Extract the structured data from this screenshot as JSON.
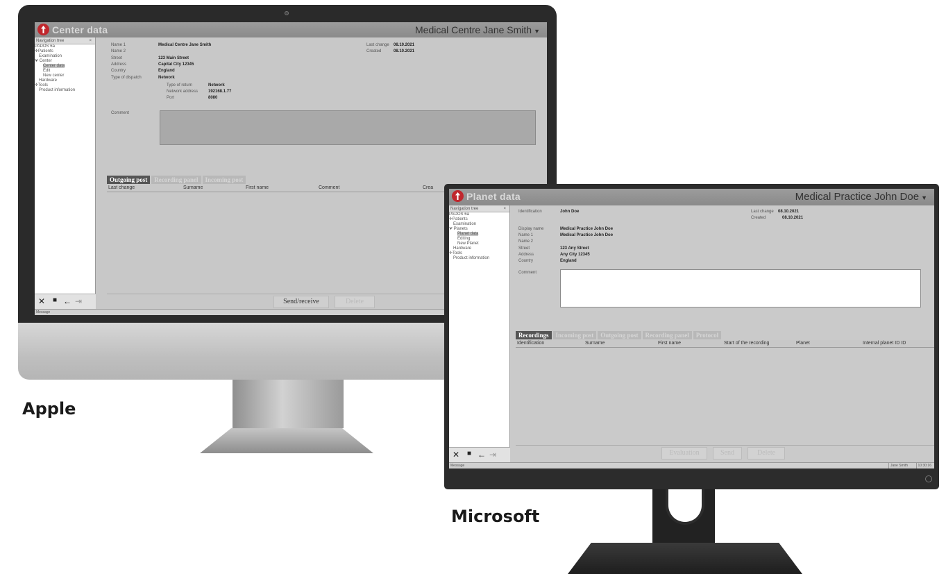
{
  "apple": {
    "caption": "Apple",
    "app": {
      "title": "Center data",
      "user": "Medical Centre Jane Smith",
      "nav": {
        "header": "Navigation tree",
        "items": [
          "PADOS 6a",
          "✛Patients",
          "Examination",
          "⮟ Center",
          "Center data",
          "Edit",
          "New center",
          "Hardware",
          "✛Tools",
          "Product information"
        ]
      },
      "form": {
        "name1_label": "Name 1",
        "name1_value": "Medical Centre Jane Smith",
        "name2_label": "Name 2",
        "street_label": "Street",
        "street_value": "123 Main Street",
        "address_label": "Address",
        "address_value": "Capital City 12345",
        "country_label": "Country",
        "country_value": "England",
        "dispatch_label": "Type of dispatch",
        "dispatch_value": "Network",
        "return_label": "Type of return",
        "return_value": "Network",
        "netaddr_label": "Network address",
        "netaddr_value": "192168.1.77",
        "port_label": "Port",
        "port_value": "8080",
        "comment_label": "Comment",
        "lastchange_label": "Last change",
        "lastchange_value": "08.10.2021",
        "created_label": "Created",
        "created_value": "08.10.2021"
      },
      "tabs": [
        "Outgoing post",
        "Recording panel",
        "Incoming post"
      ],
      "columns": [
        "Last change",
        "Surname",
        "First name",
        "Comment",
        "Crea"
      ],
      "buttons": {
        "send_receive": "Send/receive",
        "delete": "Delete"
      },
      "message": "Message"
    }
  },
  "microsoft": {
    "caption": "Microsoft",
    "app": {
      "title": "Planet data",
      "user": "Medical Practice John Doe",
      "nav": {
        "header": "Navigation tree",
        "items": [
          "PADOS 6a",
          "✛Patients",
          "Examination",
          "⮟ Planets",
          "Planet data",
          "Editing",
          "New Planet",
          "Hardware",
          "✛Tools",
          "Product information"
        ]
      },
      "form": {
        "ident_label": "Identification",
        "ident_value": "John Doe",
        "display_label": "Display name",
        "display_value": "Medical Practice John Doe",
        "name1_label": "Name 1",
        "name1_value": "Medical Practice John Doe",
        "name2_label": "Name 2",
        "street_label": "Street",
        "street_value": "123 Any Street",
        "address_label": "Address",
        "address_value": "Any City 12345",
        "country_label": "Country",
        "country_value": "England",
        "comment_label": "Comment",
        "lastchange_label": "Last change",
        "lastchange_value": "08.10.2021",
        "created_label": "Created",
        "created_value": "08.10.2021"
      },
      "tabs": [
        "Recordings",
        "Incoming post",
        "Outgoing post",
        "Recording panel",
        "Protocol"
      ],
      "columns": [
        "Identification",
        "Surname",
        "First name",
        "Start of the recording",
        "Planet",
        "Internal planet ID ID"
      ],
      "buttons": {
        "evaluation": "Evaluation",
        "send": "Send",
        "delete": "Delete"
      },
      "message": "Message",
      "status_user": "Jane Smith",
      "status_time": "10:30:16"
    }
  }
}
